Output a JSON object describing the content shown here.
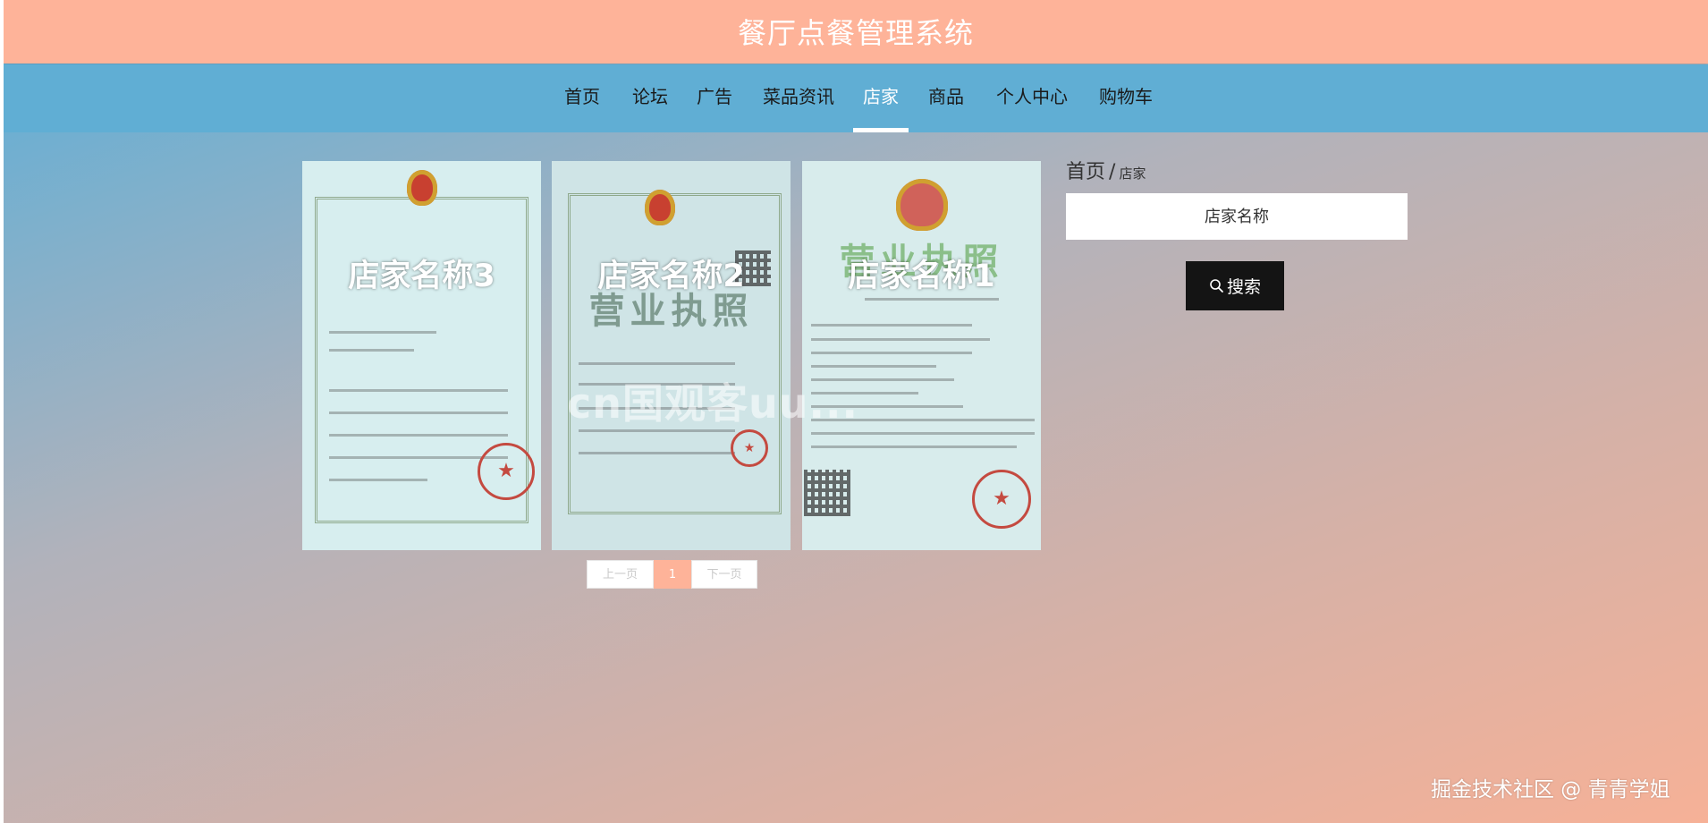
{
  "header": {
    "title": "餐厅点餐管理系统"
  },
  "nav": {
    "items": [
      {
        "label": "首页"
      },
      {
        "label": "论坛"
      },
      {
        "label": "广告"
      },
      {
        "label": "菜品资讯"
      },
      {
        "label": "店家",
        "active": true
      },
      {
        "label": "商品"
      },
      {
        "label": "个人中心"
      },
      {
        "label": "购物车"
      }
    ]
  },
  "cards": [
    {
      "name": "店家名称3"
    },
    {
      "name": "店家名称2"
    },
    {
      "name": "店家名称1"
    }
  ],
  "card_text": {
    "license_title": "营业执照"
  },
  "watermark": "cn国观客uu...",
  "pager": {
    "prev": "上一页",
    "current": "1",
    "next": "下一页"
  },
  "breadcrumb": {
    "home": "首页",
    "sep": "/",
    "current": "店家"
  },
  "search": {
    "placeholder": "店家名称",
    "button": "搜索"
  },
  "footer": {
    "credit": "掘金技术社区 @ 青青学姐"
  },
  "colors": {
    "header_bg": "#feb399",
    "nav_bg": "#60aed4",
    "search_button_bg": "#141414",
    "pager_active": "#feb399"
  }
}
